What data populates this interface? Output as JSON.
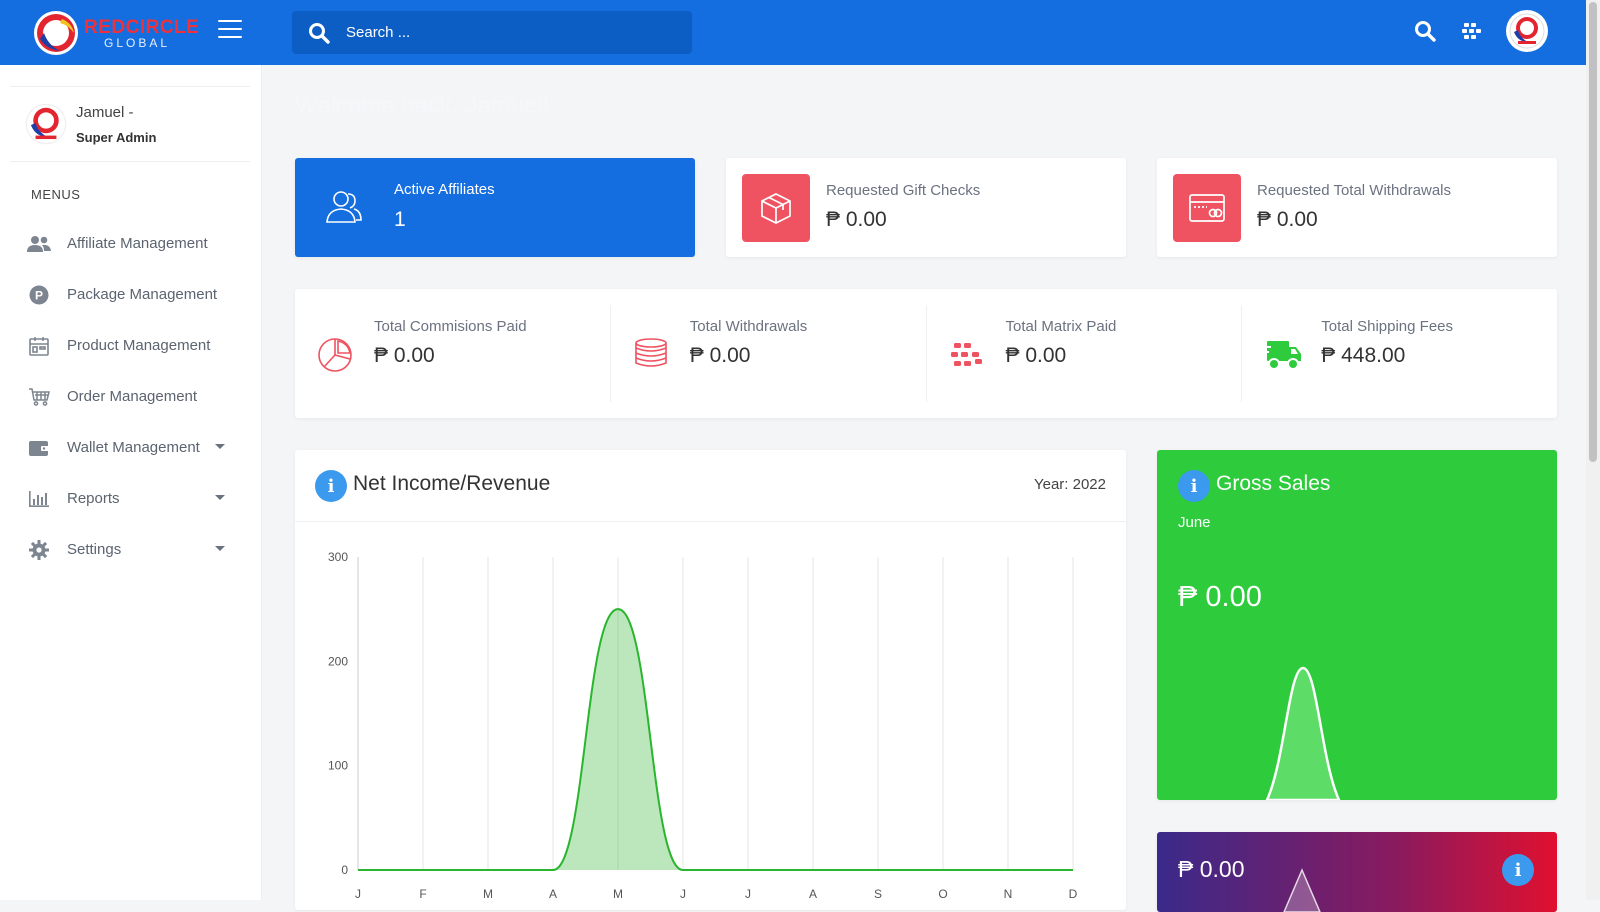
{
  "brand": {
    "name": "REDCIRCLE",
    "sub": "GLOBAL"
  },
  "search": {
    "placeholder": "Search ..."
  },
  "user": {
    "name": "Jamuel -",
    "role": "Super Admin"
  },
  "sidebar": {
    "title": "MENUS",
    "items": [
      {
        "label": "Affiliate Management",
        "icon": "users-icon",
        "has_caret": false
      },
      {
        "label": "Package Management",
        "icon": "package-icon",
        "has_caret": false
      },
      {
        "label": "Product Management",
        "icon": "product-icon",
        "has_caret": false
      },
      {
        "label": "Order Management",
        "icon": "cart-icon",
        "has_caret": false
      },
      {
        "label": "Wallet Management",
        "icon": "wallet-icon",
        "has_caret": true
      },
      {
        "label": "Reports",
        "icon": "bar-chart-icon",
        "has_caret": true
      },
      {
        "label": "Settings",
        "icon": "gear-icon",
        "has_caret": true
      }
    ]
  },
  "welcome": "Welcome back, Jamuel!",
  "stats_top": {
    "affiliates": {
      "label": "Active Affiliates",
      "value": "1"
    },
    "gift_checks": {
      "label": "Requested Gift Checks",
      "value": "₱ 0.00"
    },
    "withdrawals": {
      "label": "Requested Total Withdrawals",
      "value": "₱ 0.00"
    }
  },
  "stats_row": [
    {
      "label": "Total Commisions Paid",
      "value": "₱ 0.00",
      "icon": "pie-chart-icon"
    },
    {
      "label": "Total Withdrawals",
      "value": "₱ 0.00",
      "icon": "coins-icon"
    },
    {
      "label": "Total Matrix Paid",
      "value": "₱ 0.00",
      "icon": "matrix-icon"
    },
    {
      "label": "Total Shipping Fees",
      "value": "₱ 448.00",
      "icon": "truck-icon"
    }
  ],
  "net_income": {
    "title": "Net Income/Revenue",
    "year_label": "Year: 2022"
  },
  "gross_sales": {
    "title": "Gross Sales",
    "month": "June",
    "value": "₱ 0.00"
  },
  "bottom_card": {
    "value": "₱ 0.00"
  },
  "colors": {
    "primary": "#156ee0",
    "danger": "#ef5260",
    "success": "#2ecc3c",
    "line": "#2ab52e"
  },
  "chart_data": {
    "type": "area",
    "title": "Net Income/Revenue",
    "categories": [
      "Jan",
      "Feb",
      "Mar",
      "Apr",
      "May",
      "Jun",
      "Jul",
      "Aug",
      "Sep",
      "Oct",
      "Nov",
      "Dec"
    ],
    "tick_labels": [
      "J",
      "F",
      "M",
      "A",
      "M",
      "J",
      "J",
      "A",
      "S",
      "O",
      "N",
      "D"
    ],
    "series": [
      {
        "values": [
          0,
          0,
          0,
          0,
          250,
          0,
          0,
          0,
          0,
          0,
          0,
          0
        ]
      }
    ],
    "ylim": [
      0,
      300
    ],
    "yticks": [
      0,
      100,
      200,
      300
    ],
    "grid": true,
    "legend": "none"
  }
}
